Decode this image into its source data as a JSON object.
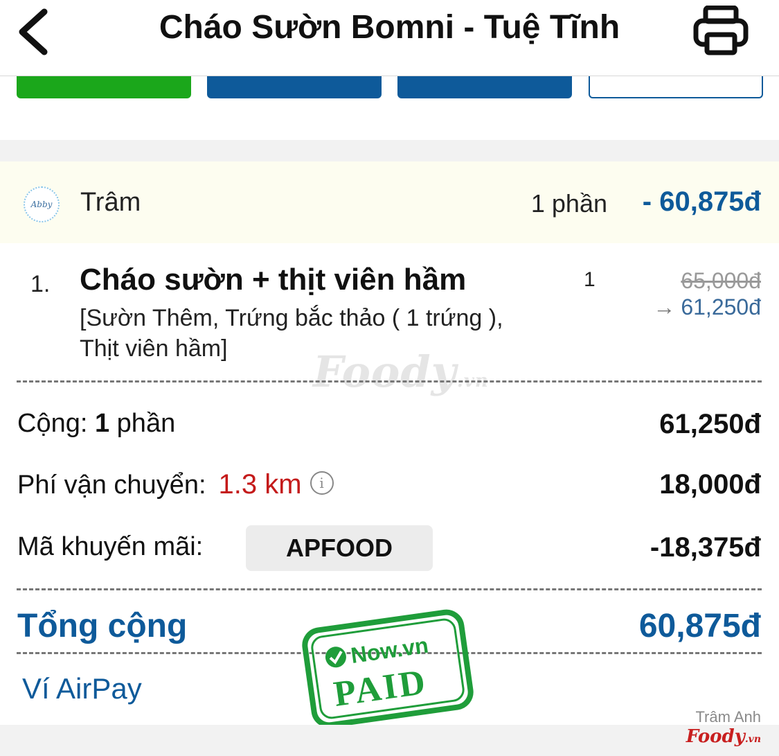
{
  "header": {
    "title": "Cháo Sườn Bomni - Tuệ Tĩnh",
    "back_icon": "chevron-left-icon",
    "print_icon": "printer-icon"
  },
  "colors": {
    "brand_blue": "#0e5a9a",
    "green": "#1ba71b",
    "red": "#c41a1a",
    "highlight_bg": "#fdfdf0"
  },
  "order_user": {
    "avatar_text": "Abby",
    "name": "Trâm",
    "quantity": "1 phần",
    "total": "- 60,875đ"
  },
  "item": {
    "index": "1.",
    "name": "Cháo sườn + thịt viên hầm",
    "options": "[Sườn Thêm, Trứng bắc thảo ( 1 trứng ), Thịt viên hầm]",
    "quantity": "1",
    "original_price": "65,000đ",
    "discounted_price": "61,250đ"
  },
  "watermark": {
    "brand": "Foody",
    "suffix": ".vn"
  },
  "summary": {
    "subtotal_label": "Cộng:",
    "subtotal_qty": "1",
    "subtotal_unit": "phần",
    "subtotal_value": "61,250đ",
    "shipping_label": "Phí vận chuyển:",
    "shipping_distance": "1.3 km",
    "shipping_value": "18,000đ",
    "promo_label": "Mã khuyến mãi:",
    "promo_code": "APFOOD",
    "promo_value": "-18,375đ",
    "total_label": "Tổng cộng",
    "total_value": "60,875đ"
  },
  "payment": {
    "method": "Ví AirPay"
  },
  "stamp": {
    "brand": "Now.vn",
    "status": "PAID"
  },
  "credit": {
    "name": "Trâm Anh",
    "logo": "Foody",
    "logo_suffix": ".vn"
  }
}
